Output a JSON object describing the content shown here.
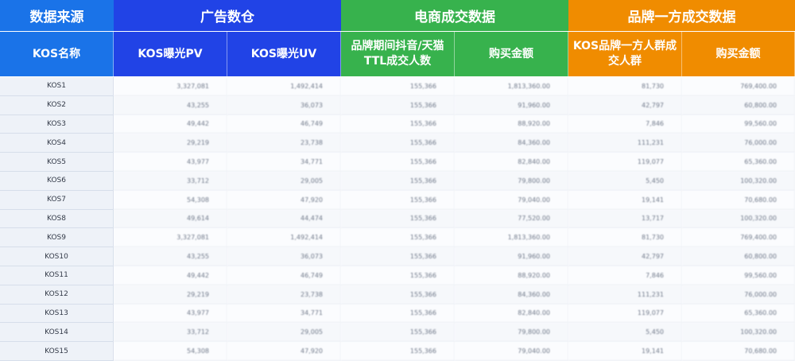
{
  "groups": [
    {
      "label": "数据来源",
      "color": "#1a73e8"
    },
    {
      "label": "广告数仓",
      "color": "#2143e6"
    },
    {
      "label": "电商成交数据",
      "color": "#37b24d"
    },
    {
      "label": "品牌一方成交数据",
      "color": "#f08c00"
    }
  ],
  "columns": [
    {
      "label": "KOS名称",
      "color": "#1a73e8"
    },
    {
      "label": "KOS曝光PV",
      "color": "#2143e6"
    },
    {
      "label": "KOS曝光UV",
      "color": "#2143e6"
    },
    {
      "label": "品牌期间抖音/天猫TTL成交人数",
      "color": "#37b24d"
    },
    {
      "label": "购买金额",
      "color": "#37b24d"
    },
    {
      "label": "KOS品牌一方人群成交人群",
      "color": "#f08c00"
    },
    {
      "label": "购买金额",
      "color": "#f08c00"
    }
  ],
  "rows": [
    {
      "name": "KOS1",
      "values": [
        "3,327,081",
        "1,492,414",
        "155,366",
        "1,813,360.00",
        "81,730",
        "769,400.00"
      ]
    },
    {
      "name": "KOS2",
      "values": [
        "43,255",
        "36,073",
        "155,366",
        "91,960.00",
        "42,797",
        "60,800.00"
      ]
    },
    {
      "name": "KOS3",
      "values": [
        "49,442",
        "46,749",
        "155,366",
        "88,920.00",
        "7,846",
        "99,560.00"
      ]
    },
    {
      "name": "KOS4",
      "values": [
        "29,219",
        "23,738",
        "155,366",
        "84,360.00",
        "111,231",
        "76,000.00"
      ]
    },
    {
      "name": "KOS5",
      "values": [
        "43,977",
        "34,771",
        "155,366",
        "82,840.00",
        "119,077",
        "65,360.00"
      ]
    },
    {
      "name": "KOS6",
      "values": [
        "33,712",
        "29,005",
        "155,366",
        "79,800.00",
        "5,450",
        "100,320.00"
      ]
    },
    {
      "name": "KOS7",
      "values": [
        "54,308",
        "47,920",
        "155,366",
        "79,040.00",
        "19,141",
        "70,680.00"
      ]
    },
    {
      "name": "KOS8",
      "values": [
        "49,614",
        "44,474",
        "155,366",
        "77,520.00",
        "13,717",
        "100,320.00"
      ]
    },
    {
      "name": "KOS9",
      "values": [
        "3,327,081",
        "1,492,414",
        "155,366",
        "1,813,360.00",
        "81,730",
        "769,400.00"
      ]
    },
    {
      "name": "KOS10",
      "values": [
        "43,255",
        "36,073",
        "155,366",
        "91,960.00",
        "42,797",
        "60,800.00"
      ]
    },
    {
      "name": "KOS11",
      "values": [
        "49,442",
        "46,749",
        "155,366",
        "88,920.00",
        "7,846",
        "99,560.00"
      ]
    },
    {
      "name": "KOS12",
      "values": [
        "29,219",
        "23,738",
        "155,366",
        "84,360.00",
        "111,231",
        "76,000.00"
      ]
    },
    {
      "name": "KOS13",
      "values": [
        "43,977",
        "34,771",
        "155,366",
        "82,840.00",
        "119,077",
        "65,360.00"
      ]
    },
    {
      "name": "KOS14",
      "values": [
        "33,712",
        "29,005",
        "155,366",
        "79,800.00",
        "5,450",
        "100,320.00"
      ]
    },
    {
      "name": "KOS15",
      "values": [
        "54,308",
        "47,920",
        "155,366",
        "79,040.00",
        "19,141",
        "70,680.00"
      ]
    }
  ]
}
